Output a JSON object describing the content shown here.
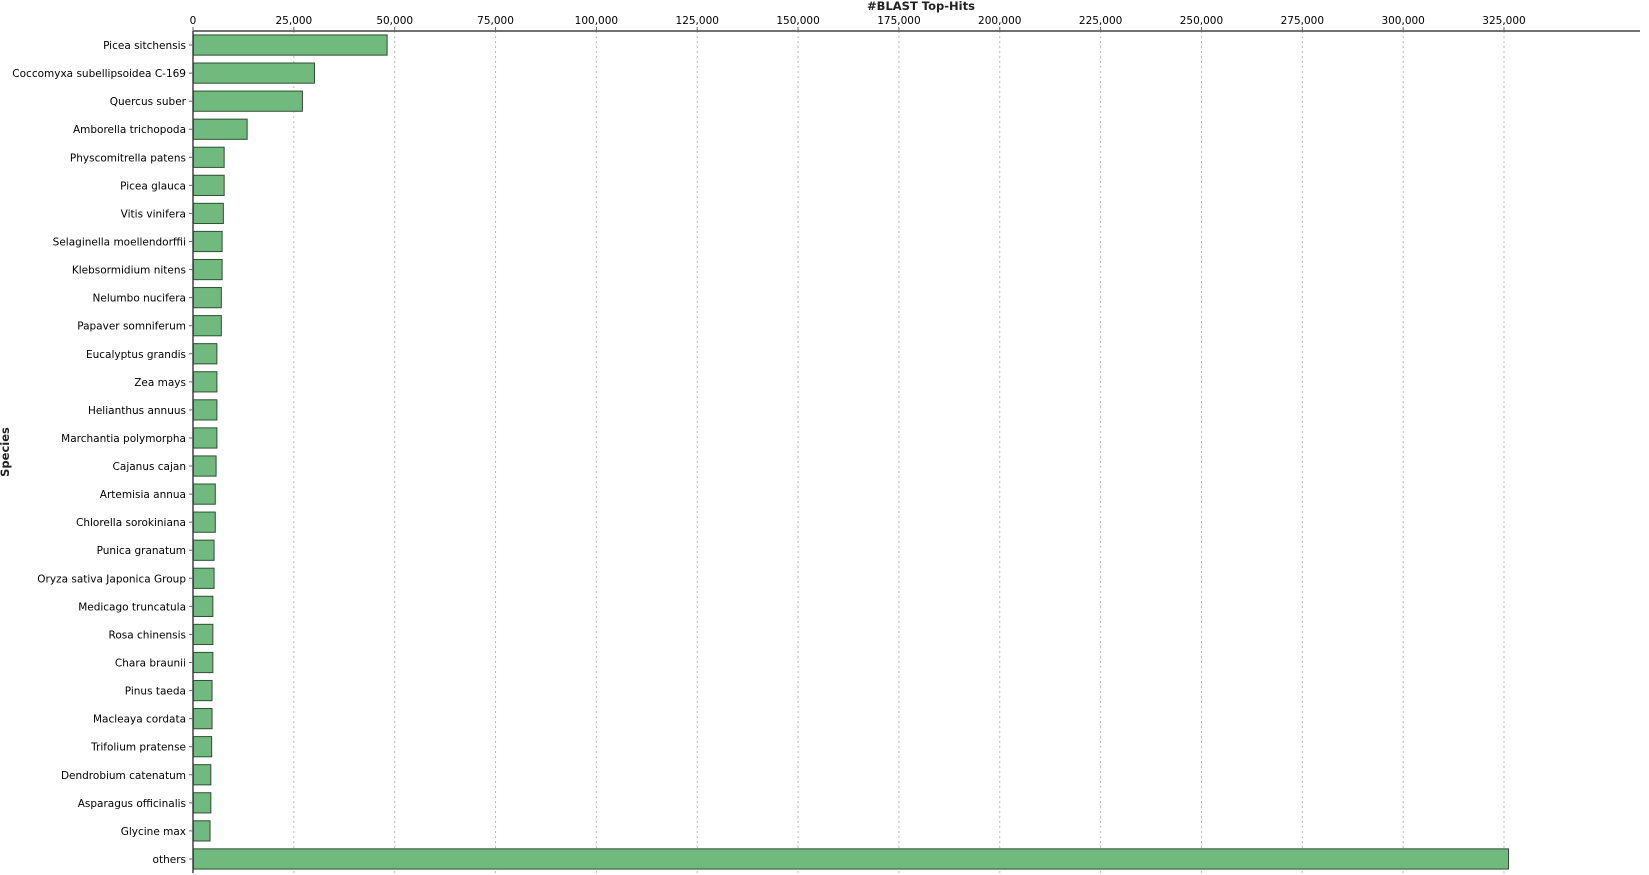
{
  "chart_data": {
    "type": "bar",
    "orientation": "horizontal",
    "title": "",
    "xlabel": "#BLAST Top-Hits",
    "ylabel": "Species",
    "xlim": [
      0,
      337000
    ],
    "x_ticks": [
      0,
      25000,
      50000,
      75000,
      100000,
      125000,
      150000,
      175000,
      200000,
      225000,
      250000,
      275000,
      300000,
      325000
    ],
    "x_tick_labels": [
      "0",
      "25,000",
      "50,000",
      "75,000",
      "100,000",
      "125,000",
      "150,000",
      "175,000",
      "200,000",
      "225,000",
      "250,000",
      "275,000",
      "300,000",
      "325,000"
    ],
    "x_axis_position": "top",
    "grid": "vertical dashed",
    "legend": "none",
    "bar_color": "#6fba7c",
    "bar_edge_color": "#2f4f35",
    "categories": [
      "Picea sitchensis",
      "Coccomyxa subellipsoidea C-169",
      "Quercus suber",
      "Amborella trichopoda",
      "Physcomitrella patens",
      "Picea glauca",
      "Vitis vinifera",
      "Selaginella moellendorffii",
      "Klebsormidium nitens",
      "Nelumbo nucifera",
      "Papaver somniferum",
      "Eucalyptus grandis",
      "Zea mays",
      "Helianthus annuus",
      "Marchantia polymorpha",
      "Cajanus cajan",
      "Artemisia annua",
      "Chlorella sorokiniana",
      "Punica granatum",
      "Oryza sativa Japonica Group",
      "Medicago truncatula",
      "Rosa chinensis",
      "Chara braunii",
      "Pinus taeda",
      "Macleaya cordata",
      "Trifolium pratense",
      "Dendrobium catenatum",
      "Asparagus officinalis",
      "Glycine max",
      "others"
    ],
    "values": [
      48000,
      30000,
      27000,
      13300,
      7600,
      7600,
      7400,
      7100,
      7100,
      6900,
      6900,
      5800,
      5800,
      5800,
      5800,
      5600,
      5400,
      5400,
      5100,
      5100,
      4800,
      4800,
      4800,
      4600,
      4600,
      4500,
      4300,
      4300,
      4100,
      326000
    ]
  }
}
